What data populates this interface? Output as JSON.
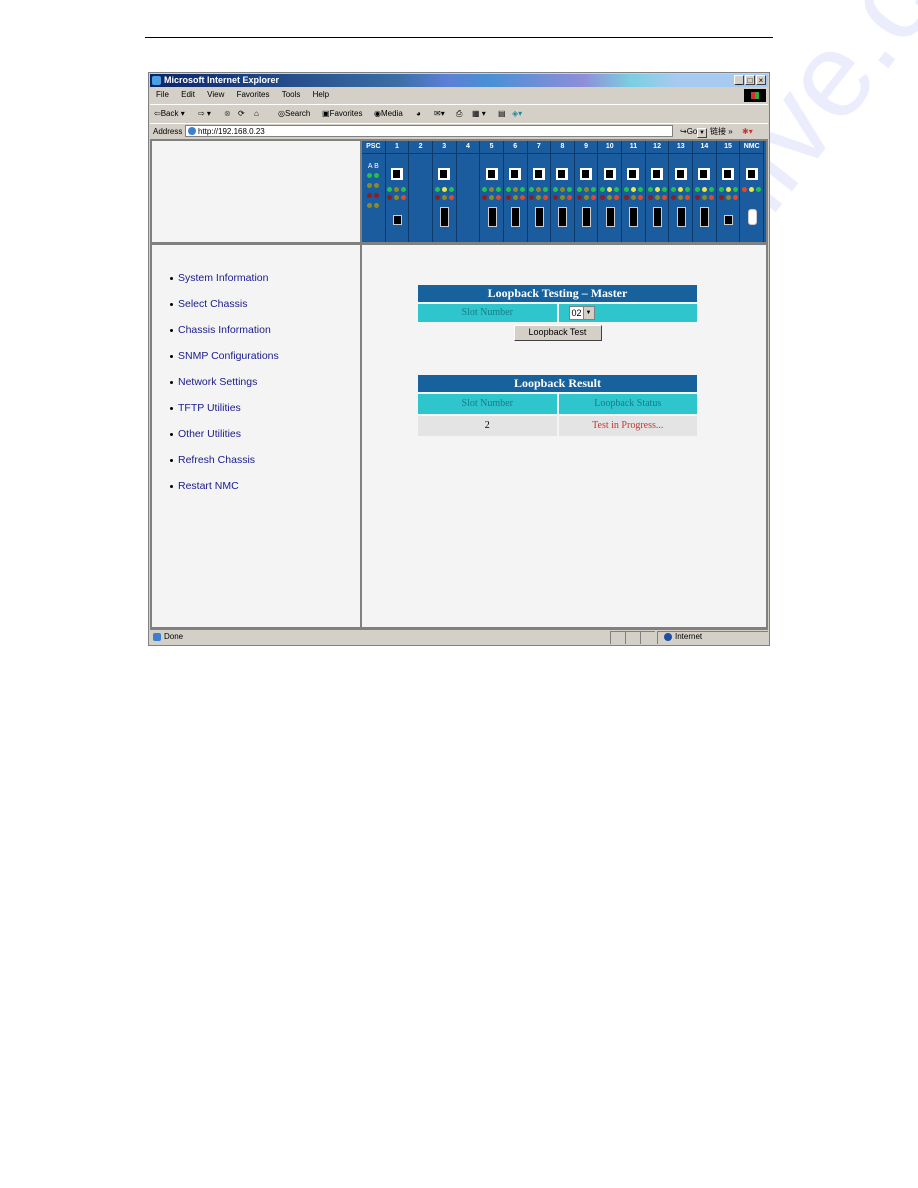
{
  "window": {
    "title": "Microsoft Internet Explorer",
    "controls": [
      "_",
      "□",
      "×"
    ]
  },
  "menubar": [
    "File",
    "Edit",
    "View",
    "Favorites",
    "Tools",
    "Help"
  ],
  "toolbar": {
    "back": "Back",
    "search": "Search",
    "favorites": "Favorites",
    "media": "Media"
  },
  "address": {
    "label": "Address",
    "url": "http://192.168.0.23",
    "go": "Go",
    "links": "链接 »"
  },
  "chassis": {
    "slots": [
      {
        "label": "PSC",
        "type": "psc"
      },
      {
        "label": "1",
        "type": "copper-single"
      },
      {
        "label": "2",
        "type": "empty"
      },
      {
        "label": "3",
        "type": "copper-dual"
      },
      {
        "label": "4",
        "type": "empty"
      },
      {
        "label": "5",
        "type": "copper-dual"
      },
      {
        "label": "6",
        "type": "copper-dual"
      },
      {
        "label": "7",
        "type": "copper-dual"
      },
      {
        "label": "8",
        "type": "copper-dual"
      },
      {
        "label": "9",
        "type": "copper-dual"
      },
      {
        "label": "10",
        "type": "copper-dual"
      },
      {
        "label": "11",
        "type": "copper-dual"
      },
      {
        "label": "12",
        "type": "copper-dual"
      },
      {
        "label": "13",
        "type": "copper-dual"
      },
      {
        "label": "14",
        "type": "copper-dual"
      },
      {
        "label": "15",
        "type": "copper-single"
      },
      {
        "label": "NMC",
        "type": "nmc"
      }
    ],
    "psc_labels": "A B"
  },
  "sidebar": {
    "items": [
      "System Information",
      "Select Chassis",
      "Chassis Information",
      "SNMP Configurations",
      "Network Settings",
      "TFTP Utilities",
      "Other Utilities",
      "Refresh Chassis",
      "Restart NMC"
    ]
  },
  "loopback_test": {
    "title": "Loopback Testing – Master",
    "slot_label": "Slot Number",
    "slot_value": "02",
    "button": "Loopback Test"
  },
  "loopback_result": {
    "title": "Loopback Result",
    "headers": [
      "Slot Number",
      "Loopback Status"
    ],
    "rows": [
      {
        "slot": "2",
        "status": "Test in Progress..."
      }
    ]
  },
  "statusbar": {
    "left": "Done",
    "zone": "Internet"
  },
  "watermark": "manualshive.com"
}
